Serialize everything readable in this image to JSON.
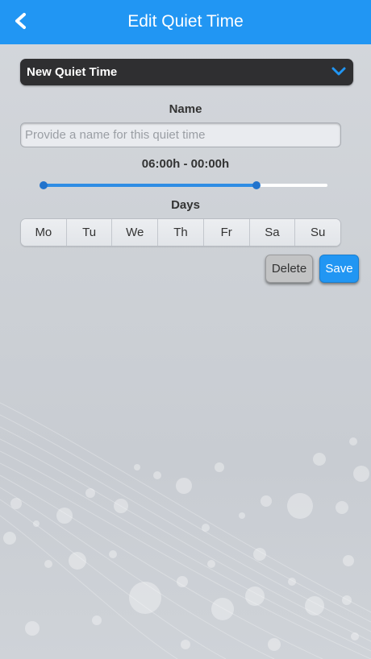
{
  "header": {
    "title": "Edit Quiet Time",
    "back_icon": "chevron-left-icon"
  },
  "selector": {
    "selected": "New Quiet Time",
    "icon": "chevron-down-icon"
  },
  "name_section": {
    "label": "Name",
    "placeholder": "Provide a name for this quiet time",
    "value": ""
  },
  "time_range": {
    "label": "06:00h - 00:00h",
    "start_fraction": 0.0,
    "end_fraction": 0.75
  },
  "days_section": {
    "label": "Days",
    "days": [
      "Mo",
      "Tu",
      "We",
      "Th",
      "Fr",
      "Sa",
      "Su"
    ]
  },
  "actions": {
    "delete_label": "Delete",
    "save_label": "Save"
  },
  "colors": {
    "header": "#2196f3",
    "accent": "#2f8de4",
    "selector_bg": "#2f2f31"
  }
}
